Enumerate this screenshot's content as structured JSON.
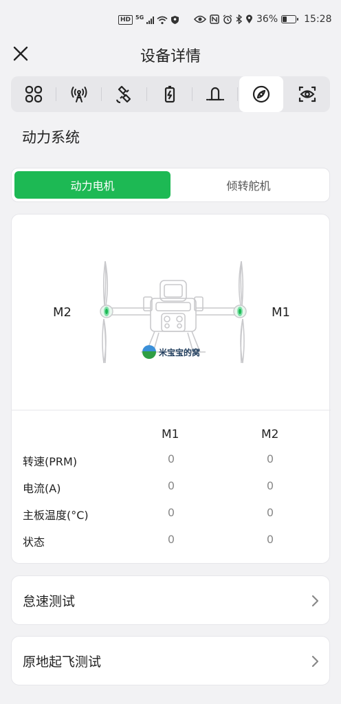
{
  "status_bar": {
    "hd": "HD",
    "net": "5G",
    "battery_text": "36%",
    "battery_level": 0.36,
    "time": "15:28"
  },
  "header": {
    "title": "设备详情"
  },
  "tabs": [
    {
      "icon": "grid-icon",
      "active": false
    },
    {
      "icon": "antenna-icon",
      "active": false
    },
    {
      "icon": "satellite-icon",
      "active": false
    },
    {
      "icon": "battery-charge-icon",
      "active": false
    },
    {
      "icon": "alarm-light-icon",
      "active": false
    },
    {
      "icon": "propeller-icon",
      "active": true
    },
    {
      "icon": "camera-eye-icon",
      "active": false
    }
  ],
  "section_title": "动力系统",
  "segmented": {
    "options": [
      "动力电机",
      "倾转舵机"
    ],
    "selected": 0,
    "accent": "#1db954"
  },
  "motor_diagram": {
    "left_label": "M2",
    "right_label": "M1",
    "watermark": "米宝宝的窝"
  },
  "motor_table": {
    "columns": [
      "M1",
      "M2"
    ],
    "rows": [
      {
        "label": "转速(PRM)",
        "m1": "0",
        "m2": "0"
      },
      {
        "label": "电流(A)",
        "m1": "0",
        "m2": "0"
      },
      {
        "label": "主板温度(°C)",
        "m1": "0",
        "m2": "0"
      },
      {
        "label": "状态",
        "m1": "0",
        "m2": "0"
      }
    ]
  },
  "actions": [
    {
      "label": "怠速测试"
    },
    {
      "label": "原地起飞测试"
    }
  ]
}
